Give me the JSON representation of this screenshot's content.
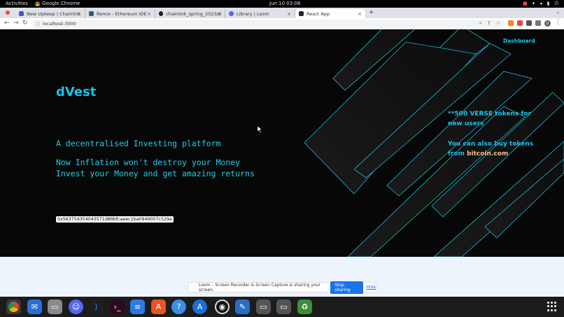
{
  "system_bar": {
    "activities": "Activities",
    "app_name": "Google Chrome",
    "clock": "Jun 10  03:06"
  },
  "tabs": [
    {
      "label": "New Upkeep | Chainlink",
      "favicon_color": "#375bd2"
    },
    {
      "label": "Remix - Ethereum IDE",
      "favicon_color": "#2f5d7c"
    },
    {
      "label": "chainlink_spring_2023/d",
      "favicon_color": "#222222"
    },
    {
      "label": "Library | Loom",
      "favicon_color": "#625df5"
    },
    {
      "label": "React App",
      "favicon_color": "#20232a"
    }
  ],
  "address_bar": {
    "url": "localhost:3000"
  },
  "site": {
    "nav_link": "Dashboard",
    "brand": "dVest",
    "tagline": "A decentralised Investing platform",
    "claim_line1": "Now Inflation won't destroy your Money",
    "claim_line2": "Invest your Money and get amazing returns",
    "wallet_address": "0x56375d354043571d89bfcaeec1ba0949007c529a",
    "promo_line1": "**500 VERSE tokens for",
    "promo_line2": "new users",
    "promo_buy_line1": "You can also buy tokens",
    "promo_buy_prefix": "from ",
    "promo_buy_link": "bitcoin.com"
  },
  "share_bar": {
    "message": "Loom – Screen Recorder & Screen Capture is sharing your screen.",
    "stop_label": "Stop sharing",
    "hide_label": "Hide"
  },
  "colors": {
    "accent": "#19c1e8",
    "link": "#f2c38c",
    "background": "#070707"
  },
  "dock": {
    "apps": [
      "chrome-icon",
      "thunderbird-icon",
      "files-icon",
      "discord-icon",
      "vscode-icon",
      "terminal-icon",
      "docs-icon",
      "app-center-icon",
      "help-icon",
      "app-store-icon",
      "obs-icon",
      "text-editor-icon",
      "drive-icon",
      "drive-icon-2",
      "trash-icon"
    ]
  }
}
